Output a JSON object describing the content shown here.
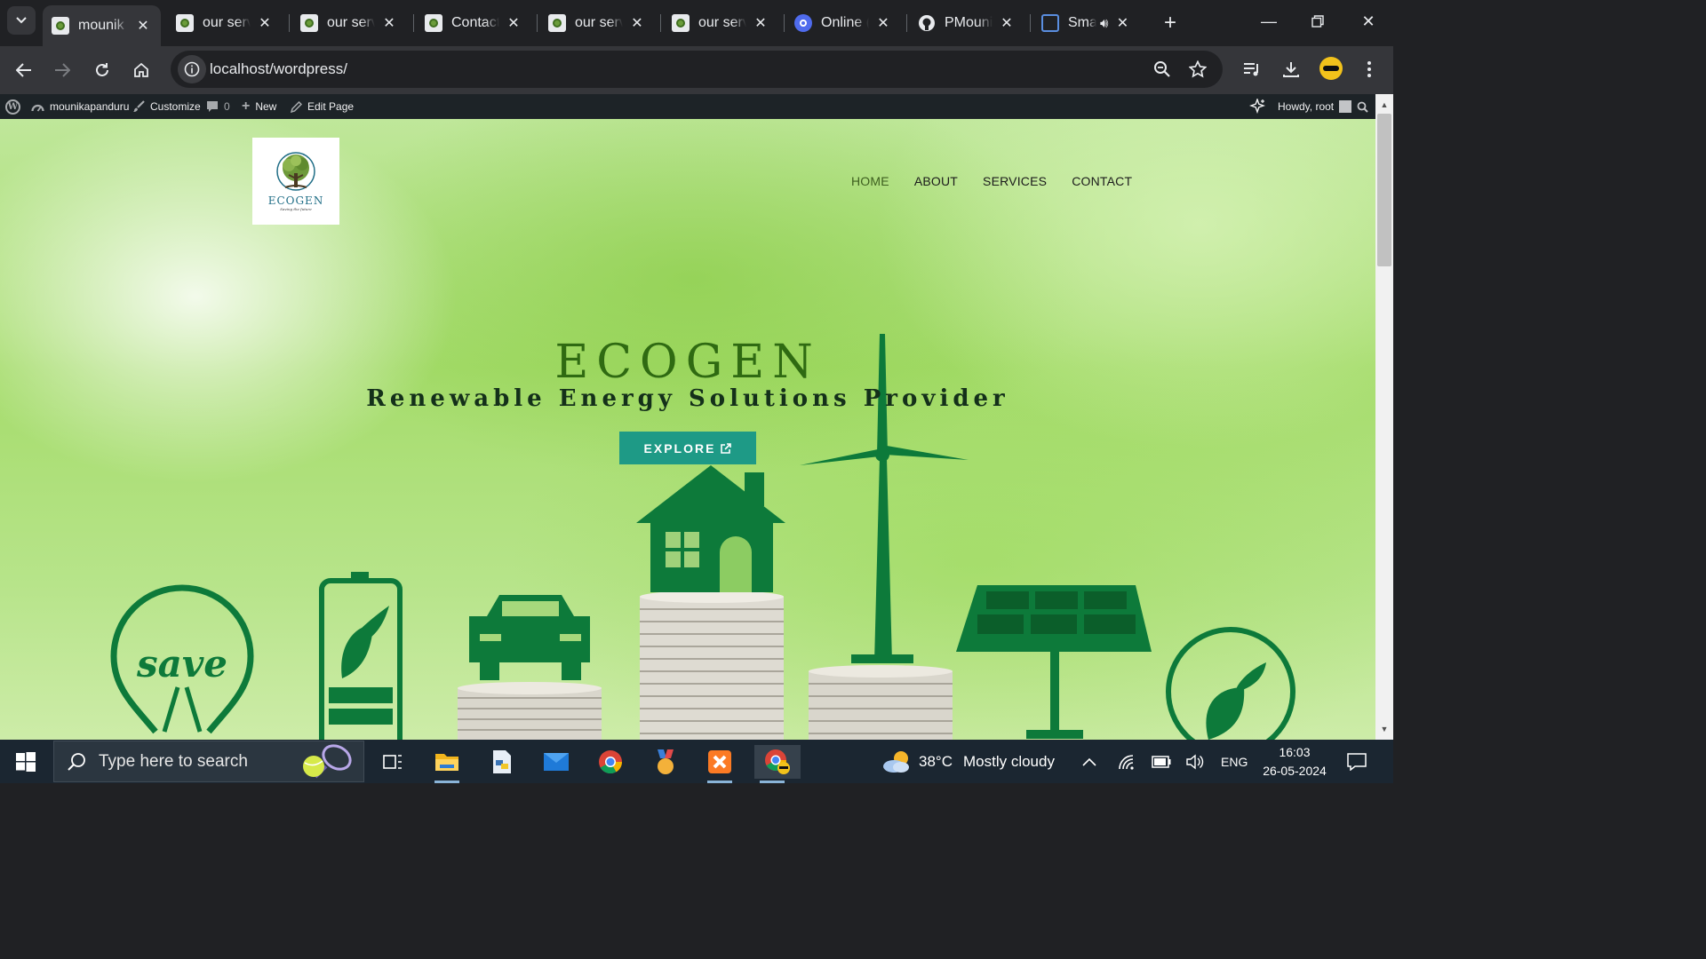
{
  "tabs": [
    {
      "title": "mounik",
      "active": true
    },
    {
      "title": "our serv",
      "active": false
    },
    {
      "title": "our serv",
      "active": false
    },
    {
      "title": "Contact",
      "active": false
    },
    {
      "title": "our serv",
      "active": false
    },
    {
      "title": "our serv",
      "active": false
    },
    {
      "title": "Online (",
      "active": false
    },
    {
      "title": "PMouni",
      "active": false
    },
    {
      "title": "Sma",
      "active": false
    }
  ],
  "address_bar": {
    "url": "localhost/wordpress/"
  },
  "wp_admin_bar": {
    "site_name": "mounikapanduru",
    "customize": "Customize",
    "comments_count": "0",
    "new": "New",
    "edit_page": "Edit Page",
    "howdy": "Howdy, root"
  },
  "site": {
    "logo": {
      "name": "ECOGEN",
      "tagline": "Saving the future"
    },
    "nav": [
      {
        "label": "HOME",
        "current": true
      },
      {
        "label": "ABOUT",
        "current": false
      },
      {
        "label": "SERVICES",
        "current": false
      },
      {
        "label": "CONTACT",
        "current": false
      }
    ],
    "hero": {
      "title": "ECOGEN",
      "subtitle": "Renewable Energy Solutions Provider",
      "button_label": "EXPLORE"
    },
    "scene_text": "save"
  },
  "taskbar": {
    "search_placeholder": "Type here to search",
    "weather_temp": "38°C",
    "weather_desc": "Mostly cloudy",
    "language": "ENG",
    "time": "16:03",
    "date": "26-05-2024"
  },
  "colors": {
    "accent_button": "#1e9a86",
    "hero_title": "#2f6a12",
    "icon_green": "#0d7a3a"
  }
}
